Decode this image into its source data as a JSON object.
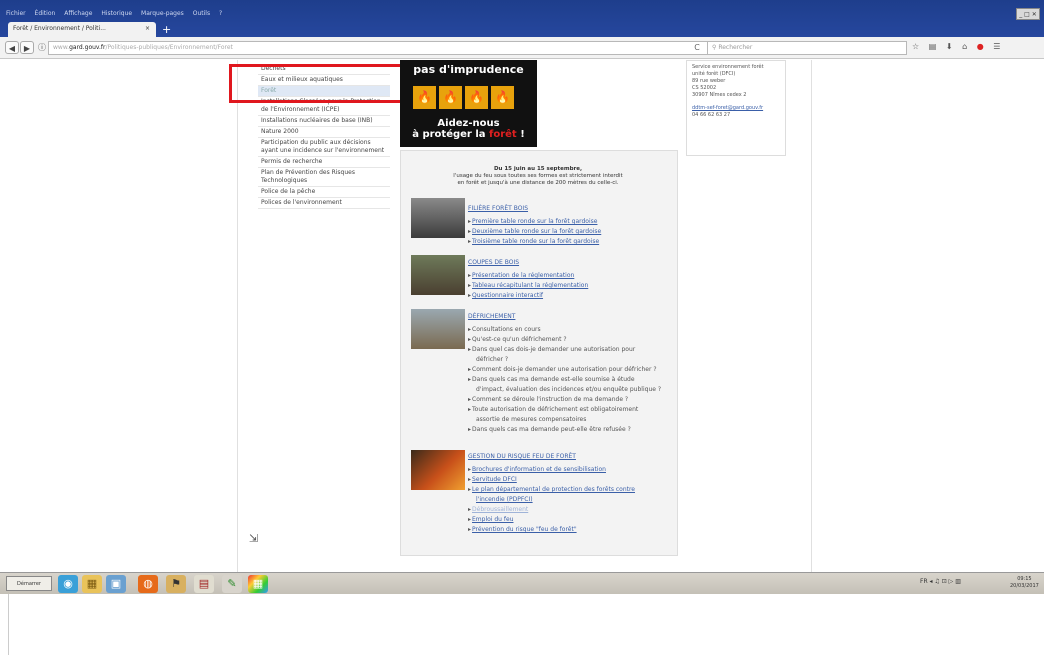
{
  "window": {
    "menu": [
      "Fichier",
      "Édition",
      "Affichage",
      "Historique",
      "Marque-pages",
      "Outils",
      "?"
    ],
    "tab_title": "Forêt / Environnement / Politi...",
    "tab_close": "×",
    "new_tab": "+",
    "controls": "_ □ ✕"
  },
  "nav": {
    "back": "◀",
    "forward": "▶",
    "info": "ⓘ",
    "url_dim": "www.",
    "url_host": "gard.gouv.fr",
    "url_path": "/Politiques-publiques/Environnement/Foret",
    "reload": "C",
    "search_placeholder": "Rechercher",
    "toolbar_icons": [
      "☆",
      "▤",
      "⬇",
      "⌂",
      "●",
      "☰"
    ]
  },
  "sidebar": {
    "items": [
      {
        "label": "Déchets"
      },
      {
        "label": "Eaux et milieux aquatiques"
      },
      {
        "label": "Forêt",
        "active": true
      },
      {
        "label": "Installations Classées pour la Protection de l'Environnement (ICPE)"
      },
      {
        "label": "Installations nucléaires de base (INB)"
      },
      {
        "label": "Nature 2000"
      },
      {
        "label": "Participation du public aux décisions ayant une incidence sur l'environnement"
      },
      {
        "label": "Permis de recherche"
      },
      {
        "label": "Plan de Prévention des Risques Technologiques"
      },
      {
        "label": "Police de la pêche"
      },
      {
        "label": "Polices de l'environnement"
      }
    ]
  },
  "banner": {
    "line1": "pas d'imprudence",
    "icons": [
      "🔥",
      "🔥",
      "🔥",
      "🔥"
    ],
    "line2": "Aidez-nous",
    "line3a": "à protéger la ",
    "line3b": "forêt",
    "line3c": " !"
  },
  "contact": {
    "lines": [
      "Service environnement forêt",
      "unité forêt (DFCI)",
      "89 rue weber",
      "CS 52002",
      "30907 Nîmes cedex 2"
    ],
    "email": "ddtm-sef-foret@gard.gouv.fr",
    "phone": "04 66 62 63 27"
  },
  "notice": {
    "line1": "Du 15 juin au 15 septembre,",
    "line2": "l'usage du feu sous toutes ses formes est strictement interdit",
    "line3": "en forêt et jusqu'à une distance de 200 mètres du celle-ci."
  },
  "sections": {
    "filiere": {
      "title": "FILIÈRE FORÊT BOIS",
      "links": [
        "Première table ronde sur la forêt gardoise",
        "Deuxième table ronde sur la forêt gardoise",
        "Troisième table ronde sur la forêt gardoise"
      ]
    },
    "coupes": {
      "title": "COUPES DE BOIS",
      "links": [
        "Présentation de la réglementation",
        "Tableau récapitulant la réglementation",
        "Questionnaire interactif"
      ]
    },
    "defrichement": {
      "title": "DÉFRICHEMENT",
      "items": [
        {
          "text": "Consultations en cours"
        },
        {
          "text": "Qu'est-ce qu'un défrichement ?"
        },
        {
          "text": "Dans quel cas dois-je demander une autorisation pour"
        },
        {
          "text": "défricher ?",
          "sub": true
        },
        {
          "text": "Comment dois-je demander une autorisation pour défricher ?"
        },
        {
          "text": "Dans quels cas ma demande est-elle soumise à étude"
        },
        {
          "text": "d'impact, évaluation des incidences et/ou enquête publique ?",
          "sub": true
        },
        {
          "text": "Comment se déroule l'instruction de ma demande ?"
        },
        {
          "text": "Toute autorisation de défrichement est obligatoirement"
        },
        {
          "text": "assortie de mesures compensatoires",
          "sub": true
        },
        {
          "text": "Dans quels cas ma demande peut-elle être refusée ?"
        }
      ]
    },
    "incendie": {
      "title": "GESTION DU RISQUE FEU DE FORÊT",
      "links": [
        {
          "text": "Brochures d'information et de sensibilisation"
        },
        {
          "text": "Servitude DFCI"
        },
        {
          "text": "Le plan départemental de protection des forêts contre"
        },
        {
          "text": "l'incendie (PDPFCI)",
          "sub": true
        },
        {
          "text": "Débroussaillement",
          "faded": true
        },
        {
          "text": "Emploi du feu"
        },
        {
          "text": "Prévention du risque \"feu de forêt\""
        }
      ]
    }
  },
  "taskbar": {
    "start": "Démarrer",
    "apps": [
      "◉",
      "▦",
      "▣",
      "◍",
      "⚑",
      "▤",
      "✎",
      "▦"
    ],
    "tray": "FR  ◂  ♫  ⊡  ▷  ▥",
    "time": "09:15",
    "date": "20/03/2017"
  },
  "cursor": "⇲"
}
